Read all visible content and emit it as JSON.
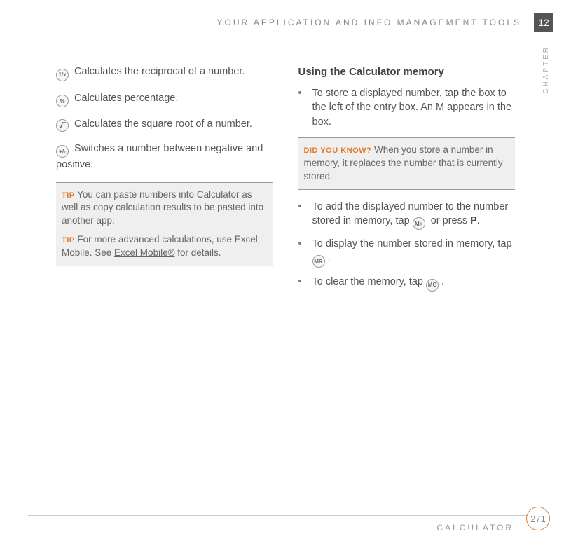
{
  "header": {
    "title": "YOUR APPLICATION AND INFO MANAGEMENT TOOLS",
    "chapter_number": "12",
    "side_label": "CHAPTER"
  },
  "left": {
    "fn1": {
      "icon": "1/x",
      "text": "Calculates the reciprocal of a number."
    },
    "fn2": {
      "icon": "%",
      "text": "Calculates percentage."
    },
    "fn3": {
      "icon": "√",
      "text": "Calculates the square root of a number."
    },
    "fn4": {
      "icon": "+/-",
      "text": "Switches a number between negative and positive."
    },
    "tip_label": "TIP",
    "tip1": "You can paste numbers into Calculator as well as copy calculation results to be pasted into another app.",
    "tip2_pre": "For more advanced calculations, use Excel Mobile. See ",
    "tip2_link": "Excel Mobile®",
    "tip2_post": " for details."
  },
  "right": {
    "heading": "Using the Calculator memory",
    "b1": "To store a displayed number, tap the box to the left of the entry box. An M appears in the box.",
    "didknow_label": "DID YOU KNOW?",
    "didknow_text": "When you store a number in memory, it replaces the number that is currently stored.",
    "b2_pre": "To add the displayed number to the number stored in memory, tap ",
    "b2_icon": "M+",
    "b2_mid": " or press ",
    "b2_bold": "P",
    "b2_post": ".",
    "b3_pre": "To display the number stored in memory, tap ",
    "b3_icon": "MR",
    "b3_post": ".",
    "b4_pre": "To clear the memory, tap ",
    "b4_icon": "MC",
    "b4_post": "."
  },
  "footer": {
    "section": "CALCULATOR",
    "page": "271"
  }
}
